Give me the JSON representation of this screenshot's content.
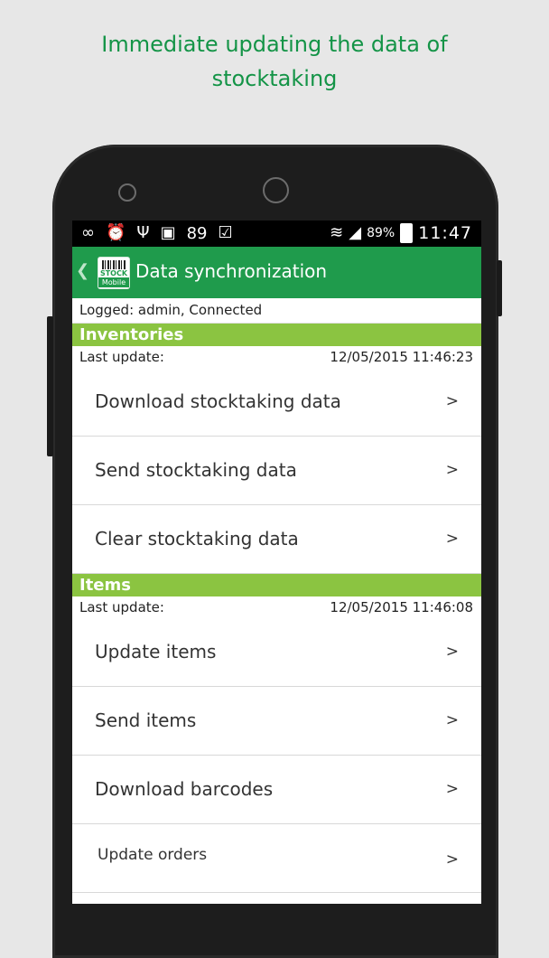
{
  "headline": {
    "line1": "Immediate updating the data of",
    "line2": "stocktaking"
  },
  "status_bar": {
    "left_icons": [
      "infinity-icon",
      "alarm-icon",
      "usb-icon",
      "image-icon"
    ],
    "count": "89",
    "battery_percent": "89%",
    "time": "11:47"
  },
  "app_bar": {
    "logo_line1": "STOCK",
    "logo_line2": "Mobile",
    "title": "Data synchronization"
  },
  "login_status": "Logged: admin,  Connected",
  "inventories": {
    "header": "Inventories",
    "last_update_label": "Last update:",
    "last_update_value": "12/05/2015 11:46:23",
    "items": [
      {
        "label": "Download stocktaking data",
        "arrow": ">"
      },
      {
        "label": "Send stocktaking data",
        "arrow": ">"
      },
      {
        "label": "Clear stocktaking data",
        "arrow": ">"
      }
    ]
  },
  "items_section": {
    "header": "Items",
    "last_update_label": "Last update:",
    "last_update_value": "12/05/2015 11:46:08",
    "items": [
      {
        "label": "Update items",
        "arrow": ">"
      },
      {
        "label": "Send items",
        "arrow": ">"
      },
      {
        "label": "Download barcodes",
        "arrow": ">"
      },
      {
        "label": "Update orders",
        "arrow": ">"
      }
    ]
  },
  "colors": {
    "headline": "#149447",
    "app_bar": "#1f9b4c",
    "section_header": "#8bc441"
  }
}
